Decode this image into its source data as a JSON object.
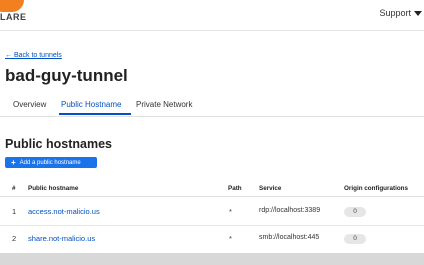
{
  "brand": {
    "logo_text": "LARE",
    "accent": "#f38020"
  },
  "header": {
    "support_label": "Support"
  },
  "nav": {
    "back_label": "← Back to tunnels"
  },
  "page": {
    "title": "bad-guy-tunnel"
  },
  "tabs": [
    {
      "label": "Overview",
      "active": false
    },
    {
      "label": "Public Hostname",
      "active": true
    },
    {
      "label": "Private Network",
      "active": false
    }
  ],
  "section": {
    "title": "Public hostnames",
    "add_button_label": "Add a public hostname"
  },
  "table": {
    "columns": [
      "#",
      "Public hostname",
      "Path",
      "Service",
      "Origin configurations"
    ],
    "rows": [
      {
        "num": "1",
        "hostname": "access.not-malicio.us",
        "path": "*",
        "service": "rdp://localhost:3389",
        "origin": "0"
      },
      {
        "num": "2",
        "hostname": "share.not-malicio.us",
        "path": "*",
        "service": "smb://localhost:445",
        "origin": "0"
      }
    ]
  },
  "colors": {
    "link": "#0051c3",
    "button": "#1a73e8"
  }
}
